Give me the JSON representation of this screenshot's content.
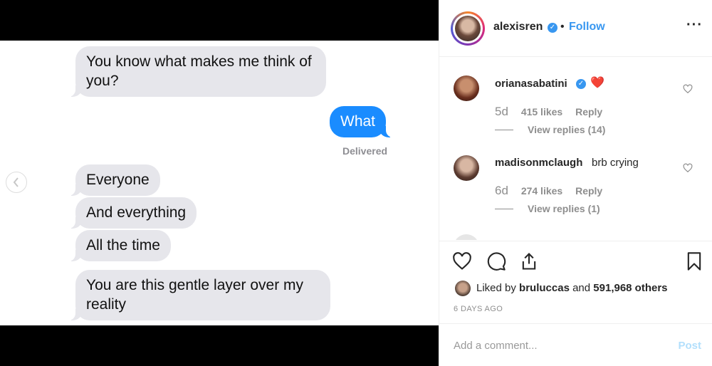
{
  "messages": {
    "m1": "You know what makes me think of you?",
    "m2": "What",
    "delivered": "Delivered",
    "m3": "Everyone",
    "m4": "And everything",
    "m5": "All the time",
    "m6": "You are this gentle layer over my reality"
  },
  "carousel": {
    "prev_icon": "chevron-left-icon",
    "dots_total": 2,
    "active_dot": 2
  },
  "post": {
    "username": "alexisren",
    "follow_label": "Follow",
    "bullet": "•",
    "verified": true
  },
  "comments": [
    {
      "username": "orianasabatini",
      "verified": true,
      "text": "❤️",
      "age": "5d",
      "likes": "415 likes",
      "reply_label": "Reply",
      "view_replies": "View replies (14)"
    },
    {
      "username": "madisonmclaugh",
      "verified": false,
      "text": "brb crying",
      "age": "6d",
      "likes": "274 likes",
      "reply_label": "Reply",
      "view_replies": "View replies (1)"
    }
  ],
  "likes": {
    "prefix": "Liked by",
    "user": "bruluccas",
    "and": "and",
    "others": "591,968 others"
  },
  "time_ago": "6 DAYS AGO",
  "add_comment": {
    "placeholder": "Add a comment...",
    "post_label": "Post"
  },
  "colors": {
    "accent": "#3897f0",
    "imessage_blue": "#1a8cff",
    "bubble_gray": "#e6e6eb",
    "like_red": "#ed4956"
  }
}
